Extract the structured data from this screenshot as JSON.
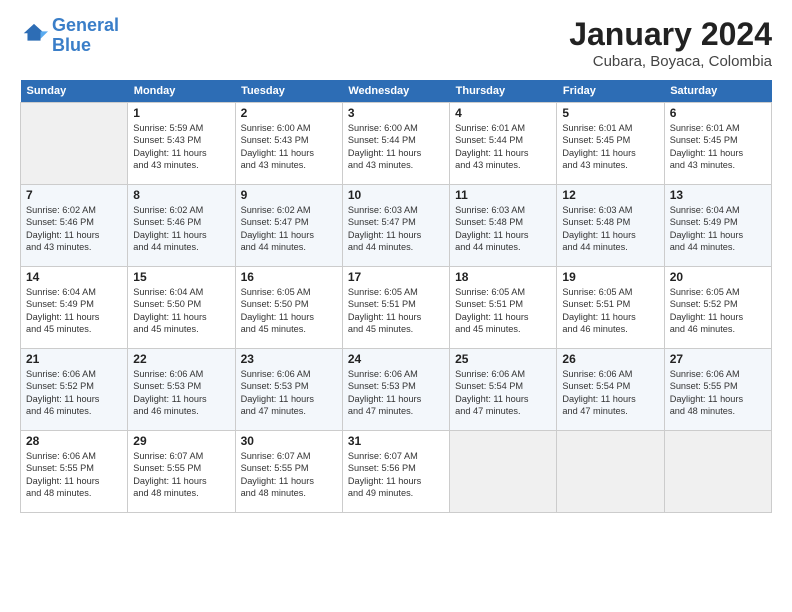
{
  "header": {
    "logo_line1": "General",
    "logo_line2": "Blue",
    "month": "January 2024",
    "location": "Cubara, Boyaca, Colombia"
  },
  "weekdays": [
    "Sunday",
    "Monday",
    "Tuesday",
    "Wednesday",
    "Thursday",
    "Friday",
    "Saturday"
  ],
  "weeks": [
    [
      {
        "day": "",
        "info": ""
      },
      {
        "day": "1",
        "info": "Sunrise: 5:59 AM\nSunset: 5:43 PM\nDaylight: 11 hours\nand 43 minutes."
      },
      {
        "day": "2",
        "info": "Sunrise: 6:00 AM\nSunset: 5:43 PM\nDaylight: 11 hours\nand 43 minutes."
      },
      {
        "day": "3",
        "info": "Sunrise: 6:00 AM\nSunset: 5:44 PM\nDaylight: 11 hours\nand 43 minutes."
      },
      {
        "day": "4",
        "info": "Sunrise: 6:01 AM\nSunset: 5:44 PM\nDaylight: 11 hours\nand 43 minutes."
      },
      {
        "day": "5",
        "info": "Sunrise: 6:01 AM\nSunset: 5:45 PM\nDaylight: 11 hours\nand 43 minutes."
      },
      {
        "day": "6",
        "info": "Sunrise: 6:01 AM\nSunset: 5:45 PM\nDaylight: 11 hours\nand 43 minutes."
      }
    ],
    [
      {
        "day": "7",
        "info": "Sunrise: 6:02 AM\nSunset: 5:46 PM\nDaylight: 11 hours\nand 43 minutes."
      },
      {
        "day": "8",
        "info": "Sunrise: 6:02 AM\nSunset: 5:46 PM\nDaylight: 11 hours\nand 44 minutes."
      },
      {
        "day": "9",
        "info": "Sunrise: 6:02 AM\nSunset: 5:47 PM\nDaylight: 11 hours\nand 44 minutes."
      },
      {
        "day": "10",
        "info": "Sunrise: 6:03 AM\nSunset: 5:47 PM\nDaylight: 11 hours\nand 44 minutes."
      },
      {
        "day": "11",
        "info": "Sunrise: 6:03 AM\nSunset: 5:48 PM\nDaylight: 11 hours\nand 44 minutes."
      },
      {
        "day": "12",
        "info": "Sunrise: 6:03 AM\nSunset: 5:48 PM\nDaylight: 11 hours\nand 44 minutes."
      },
      {
        "day": "13",
        "info": "Sunrise: 6:04 AM\nSunset: 5:49 PM\nDaylight: 11 hours\nand 44 minutes."
      }
    ],
    [
      {
        "day": "14",
        "info": "Sunrise: 6:04 AM\nSunset: 5:49 PM\nDaylight: 11 hours\nand 45 minutes."
      },
      {
        "day": "15",
        "info": "Sunrise: 6:04 AM\nSunset: 5:50 PM\nDaylight: 11 hours\nand 45 minutes."
      },
      {
        "day": "16",
        "info": "Sunrise: 6:05 AM\nSunset: 5:50 PM\nDaylight: 11 hours\nand 45 minutes."
      },
      {
        "day": "17",
        "info": "Sunrise: 6:05 AM\nSunset: 5:51 PM\nDaylight: 11 hours\nand 45 minutes."
      },
      {
        "day": "18",
        "info": "Sunrise: 6:05 AM\nSunset: 5:51 PM\nDaylight: 11 hours\nand 45 minutes."
      },
      {
        "day": "19",
        "info": "Sunrise: 6:05 AM\nSunset: 5:51 PM\nDaylight: 11 hours\nand 46 minutes."
      },
      {
        "day": "20",
        "info": "Sunrise: 6:05 AM\nSunset: 5:52 PM\nDaylight: 11 hours\nand 46 minutes."
      }
    ],
    [
      {
        "day": "21",
        "info": "Sunrise: 6:06 AM\nSunset: 5:52 PM\nDaylight: 11 hours\nand 46 minutes."
      },
      {
        "day": "22",
        "info": "Sunrise: 6:06 AM\nSunset: 5:53 PM\nDaylight: 11 hours\nand 46 minutes."
      },
      {
        "day": "23",
        "info": "Sunrise: 6:06 AM\nSunset: 5:53 PM\nDaylight: 11 hours\nand 47 minutes."
      },
      {
        "day": "24",
        "info": "Sunrise: 6:06 AM\nSunset: 5:53 PM\nDaylight: 11 hours\nand 47 minutes."
      },
      {
        "day": "25",
        "info": "Sunrise: 6:06 AM\nSunset: 5:54 PM\nDaylight: 11 hours\nand 47 minutes."
      },
      {
        "day": "26",
        "info": "Sunrise: 6:06 AM\nSunset: 5:54 PM\nDaylight: 11 hours\nand 47 minutes."
      },
      {
        "day": "27",
        "info": "Sunrise: 6:06 AM\nSunset: 5:55 PM\nDaylight: 11 hours\nand 48 minutes."
      }
    ],
    [
      {
        "day": "28",
        "info": "Sunrise: 6:06 AM\nSunset: 5:55 PM\nDaylight: 11 hours\nand 48 minutes."
      },
      {
        "day": "29",
        "info": "Sunrise: 6:07 AM\nSunset: 5:55 PM\nDaylight: 11 hours\nand 48 minutes."
      },
      {
        "day": "30",
        "info": "Sunrise: 6:07 AM\nSunset: 5:55 PM\nDaylight: 11 hours\nand 48 minutes."
      },
      {
        "day": "31",
        "info": "Sunrise: 6:07 AM\nSunset: 5:56 PM\nDaylight: 11 hours\nand 49 minutes."
      },
      {
        "day": "",
        "info": ""
      },
      {
        "day": "",
        "info": ""
      },
      {
        "day": "",
        "info": ""
      }
    ]
  ]
}
